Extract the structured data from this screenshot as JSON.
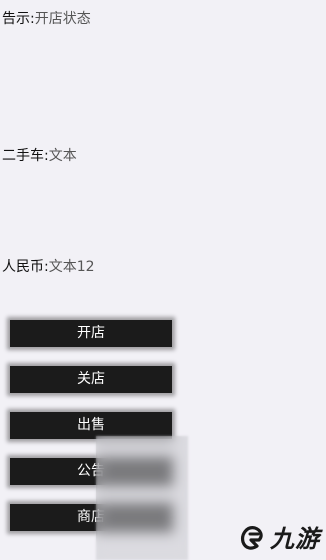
{
  "rows": {
    "notice": {
      "label": "告示:",
      "value": "开店状态"
    },
    "secondhand": {
      "label": "二手车:",
      "value": "文本"
    },
    "rmb": {
      "label": "人民币:",
      "value": "文本12"
    }
  },
  "buttons": {
    "open": "开店",
    "close": "关店",
    "sell": "出售",
    "notice": "公告",
    "shop": "商店"
  },
  "watermark": {
    "text": "九游",
    "icon": "jiuyou-logo-icon"
  }
}
